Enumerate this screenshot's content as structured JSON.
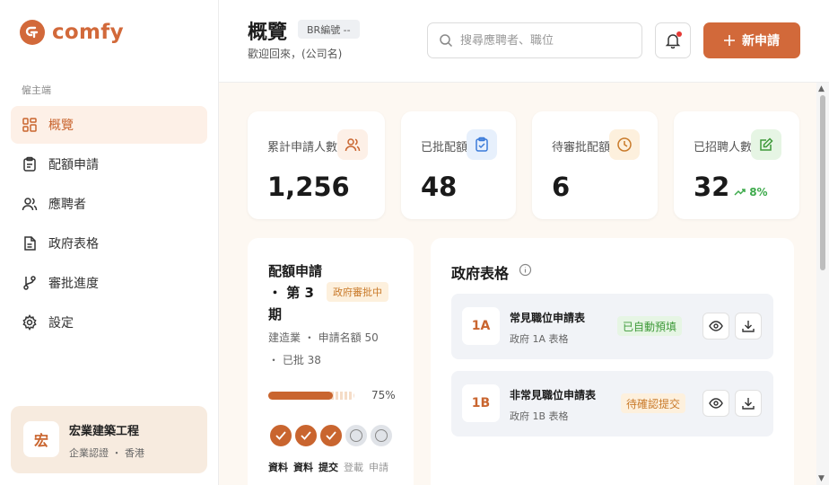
{
  "brand": {
    "name": "comfy",
    "accent": "#d2693a"
  },
  "sidebar": {
    "section_label": "僱主端",
    "items": [
      {
        "label": "概覽",
        "icon": "grid-icon",
        "active": true
      },
      {
        "label": "配額申請",
        "icon": "clipboard-icon",
        "active": false
      },
      {
        "label": "應聘者",
        "icon": "users-icon",
        "active": false
      },
      {
        "label": "政府表格",
        "icon": "document-icon",
        "active": false
      },
      {
        "label": "審批進度",
        "icon": "git-branch-icon",
        "active": false
      },
      {
        "label": "設定",
        "icon": "gear-icon",
        "active": false
      }
    ],
    "org": {
      "avatar": "宏",
      "name": "宏業建築工程",
      "sub": "企業認證 ・ 香港"
    }
  },
  "header": {
    "title": "概覽",
    "br_badge": "BR編號 --",
    "welcome": "歡迎回來，(公司名)",
    "search_placeholder": "搜尋應聘者、職位",
    "new_button": "新申請"
  },
  "stats": [
    {
      "label": "累計申請人數",
      "value": "1,256",
      "icon": "users-icon"
    },
    {
      "label": "已批配額",
      "value": "48",
      "icon": "clipboard-check-icon"
    },
    {
      "label": "待審批配額",
      "value": "6",
      "icon": "clock-icon"
    },
    {
      "label": "已招聘人數",
      "value": "32",
      "icon": "edit-icon",
      "trend": "8%"
    }
  ],
  "quota": {
    "title": "配額申請 ・ 第 3 期",
    "badge": "政府審批中",
    "sub": "建造業 ・ 申請名額 50 ・ 已批 38",
    "progress_pct": 75,
    "progress_label": "75%",
    "steps": [
      {
        "label": "資料",
        "done": true
      },
      {
        "label": "資料",
        "done": true
      },
      {
        "label": "提交",
        "done": true
      },
      {
        "label": "登載",
        "done": false
      },
      {
        "label": "申請",
        "done": false
      }
    ]
  },
  "forms": {
    "title": "政府表格",
    "items": [
      {
        "code": "1A",
        "name": "常見職位申請表",
        "sub": "政府 1A 表格",
        "status": "已自動預填",
        "status_type": "ok"
      },
      {
        "code": "1B",
        "name": "非常見職位申請表",
        "sub": "政府 1B 表格",
        "status": "待確認提交",
        "status_type": "wait"
      }
    ]
  }
}
